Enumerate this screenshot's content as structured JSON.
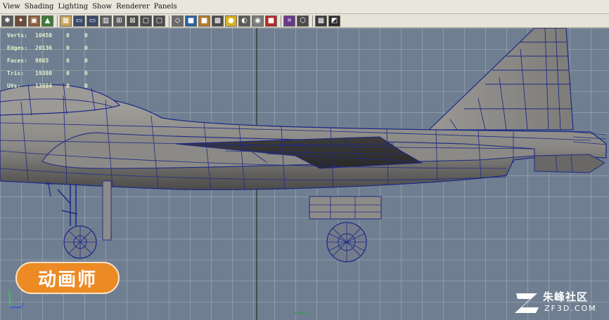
{
  "menu": [
    "View",
    "Shading",
    "Lighting",
    "Show",
    "Renderer",
    "Panels"
  ],
  "toolbar": {
    "icons": [
      {
        "name": "select-camera-icon",
        "glyph": "✱",
        "color": "#5a5a5a"
      },
      {
        "name": "lock-camera-icon",
        "glyph": "✦",
        "color": "#6a4a3a"
      },
      {
        "name": "camera-attributes-icon",
        "glyph": "▣",
        "color": "#8a5a3a"
      },
      {
        "name": "bookmark-icon",
        "glyph": "▲",
        "color": "#3f7a3a"
      },
      {
        "name": "image-plane-icon",
        "glyph": "▦",
        "color": "#c9a25a"
      },
      {
        "name": "grid-icon",
        "glyph": "▭",
        "color": "#3a4a6a"
      },
      {
        "name": "film-gate-icon",
        "glyph": "▭",
        "color": "#3a4a6a"
      },
      {
        "name": "resolution-gate-icon",
        "glyph": "▥",
        "color": "#5a5a5a"
      },
      {
        "name": "gate-mask-icon",
        "glyph": "⊞",
        "color": "#5a5a5a"
      },
      {
        "name": "field-chart-icon",
        "glyph": "⊠",
        "color": "#4a4a4a"
      },
      {
        "name": "safe-action-icon",
        "glyph": "▢",
        "color": "#4a4a4a"
      },
      {
        "name": "safe-title-icon",
        "glyph": "▢",
        "color": "#4a4a4a"
      },
      {
        "name": "wireframe-icon",
        "glyph": "◇",
        "color": "#6a6a6a"
      },
      {
        "name": "smooth-shade-icon",
        "glyph": "■",
        "color": "#2a5fa0"
      },
      {
        "name": "wireframe-on-shaded-icon",
        "glyph": "■",
        "color": "#b47a2a"
      },
      {
        "name": "textured-icon",
        "glyph": "▩",
        "color": "#4a4a4a"
      },
      {
        "name": "use-lights-icon",
        "glyph": "●",
        "color": "#d8b21c"
      },
      {
        "name": "shadows-icon",
        "glyph": "◐",
        "color": "#5a5a5a"
      },
      {
        "name": "xray-icon",
        "glyph": "◉",
        "color": "#7a7a7a"
      },
      {
        "name": "xray-joints-icon",
        "glyph": "■",
        "color": "#b02a2a"
      },
      {
        "name": "isolate-select-icon",
        "glyph": "⌗",
        "color": "#6a3a8a"
      },
      {
        "name": "backface-culling-icon",
        "glyph": "⬡",
        "color": "#4a4a4a"
      },
      {
        "name": "hud-icon",
        "glyph": "▦",
        "color": "#3a3a3a"
      },
      {
        "name": "toggle-panels-icon",
        "glyph": "◩",
        "color": "#2a2a2a"
      }
    ]
  },
  "hud": [
    {
      "label": "Verts:",
      "v1": "10450",
      "v2": "0",
      "v3": "0"
    },
    {
      "label": "Edges:",
      "v1": "20136",
      "v2": "0",
      "v3": "0"
    },
    {
      "label": "Faces:",
      "v1": "9865",
      "v2": "0",
      "v3": "0"
    },
    {
      "label": "Tris:",
      "v1": "19380",
      "v2": "0",
      "v3": "0"
    },
    {
      "label": "UVs:",
      "v1": "13884",
      "v2": "0",
      "v3": "0"
    }
  ],
  "badge": {
    "text": "动画师"
  },
  "watermark": {
    "name": "朱峰社区",
    "domain": "ZF3D.COM"
  },
  "colors": {
    "viewport_bg": "#6f7f91",
    "grid_line": "#c9cfd6",
    "wire": "#1e2a86",
    "hull_light": "#8e8c88",
    "hull_dark": "#4a4846",
    "badge_orange": "#ec8a24"
  }
}
